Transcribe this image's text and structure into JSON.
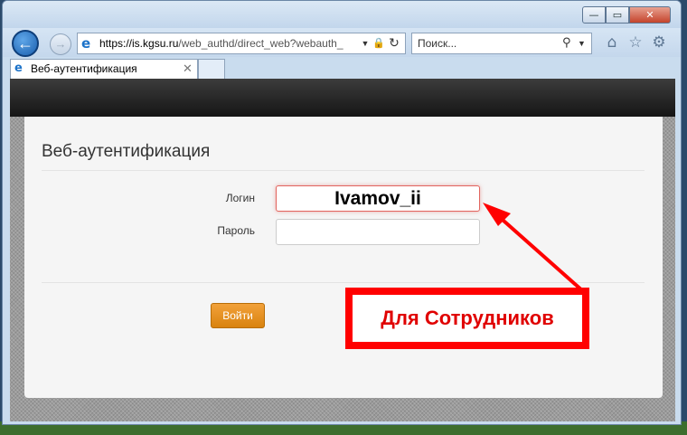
{
  "window_controls": {
    "minimize_icon": "—",
    "maximize_icon": "▭",
    "close_icon": "✕"
  },
  "navbar": {
    "back_icon": "←",
    "forward_icon": "→",
    "address_host": "https://is.kgsu.ru",
    "address_path": "/web_authd/direct_web?webauth_",
    "search_placeholder": "Поиск...",
    "icons": [
      "home-icon",
      "favorites-star-icon",
      "settings-gear-icon"
    ]
  },
  "tab": {
    "title": "Веб-аутентификация",
    "close_icon": "✕"
  },
  "form": {
    "heading": "Веб-аутентификация",
    "login_label": "Логин",
    "password_label": "Пароль",
    "login_value": "Ivamov_ii",
    "submit_label": "Войти"
  },
  "annotation": {
    "callout_text": "Для Сотрудников",
    "color": "#ff0000"
  }
}
